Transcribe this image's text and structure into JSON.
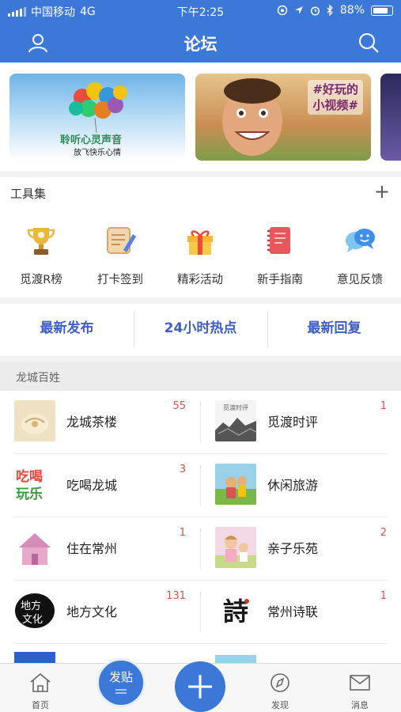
{
  "status_bar": {
    "carrier": "中国移动",
    "network": "4G",
    "time": "下午2:25",
    "battery": "88%"
  },
  "nav": {
    "title": "论坛",
    "left_icon": "user-icon",
    "right_icon": "search-icon"
  },
  "banners": [
    {
      "brand": "聆听心灵声音",
      "caption": "放飞快乐心情"
    },
    {
      "overlay_text": "#好玩的\n小视频#"
    },
    {}
  ],
  "tools": {
    "title": "工具集",
    "add_symbol": "+",
    "items": [
      {
        "label": "觅渡R榜",
        "icon": "trophy-icon"
      },
      {
        "label": "打卡签到",
        "icon": "scroll-pen-icon"
      },
      {
        "label": "精彩活动",
        "icon": "gift-icon"
      },
      {
        "label": "新手指南",
        "icon": "notebook-icon"
      },
      {
        "label": "意见反馈",
        "icon": "chat-bubble-icon"
      }
    ]
  },
  "quick_tabs": [
    "最新发布",
    "24小时热点",
    "最新回复"
  ],
  "section": {
    "title": "龙城百姓"
  },
  "forums": [
    {
      "name": "龙城茶楼",
      "count": "55"
    },
    {
      "name": "觅渡时评",
      "count": "1"
    },
    {
      "name": "吃喝龙城",
      "count": "3"
    },
    {
      "name": "休闲旅游",
      "count": ""
    },
    {
      "name": "住在常州",
      "count": "1"
    },
    {
      "name": "亲子乐苑",
      "count": "2"
    },
    {
      "name": "地方文化",
      "count": "131"
    },
    {
      "name": "常州诗联",
      "count": "1"
    }
  ],
  "thumb_texts": {
    "chihe": [
      "吃喝",
      "玩乐"
    ],
    "difang": [
      "地方",
      "文化"
    ],
    "shi": "詩",
    "mudu": "觅渡时评"
  },
  "tabbar": {
    "home": "首页",
    "post": "发贴",
    "discover": "发现",
    "messages": "消息"
  },
  "colors": {
    "primary": "#3b78d8",
    "badge": "#d9534f",
    "quick_text": "#3f5ec4"
  }
}
